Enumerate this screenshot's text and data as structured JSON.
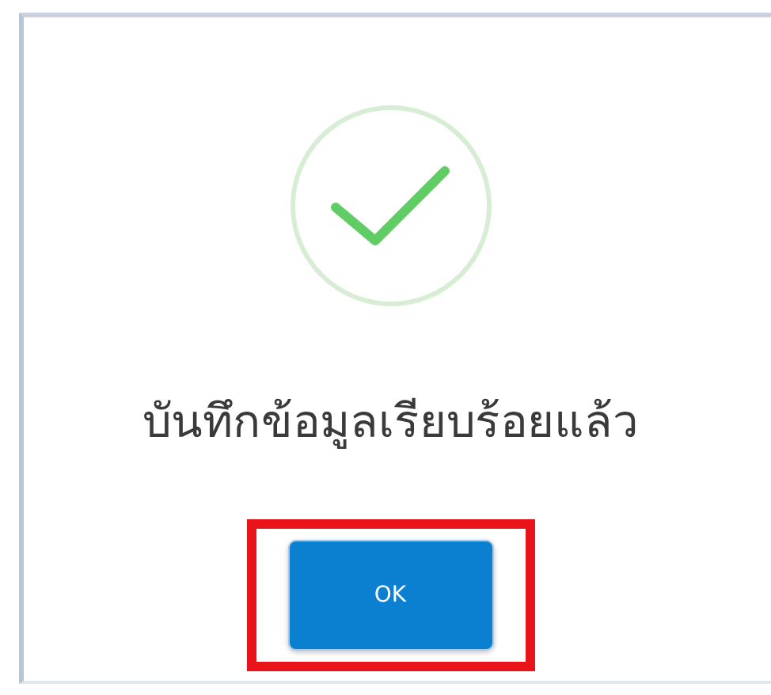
{
  "dialog": {
    "message": "บันทึกข้อมูลเรียบร้อยแล้ว",
    "button": {
      "label": "OK",
      "highlighted": true
    }
  }
}
